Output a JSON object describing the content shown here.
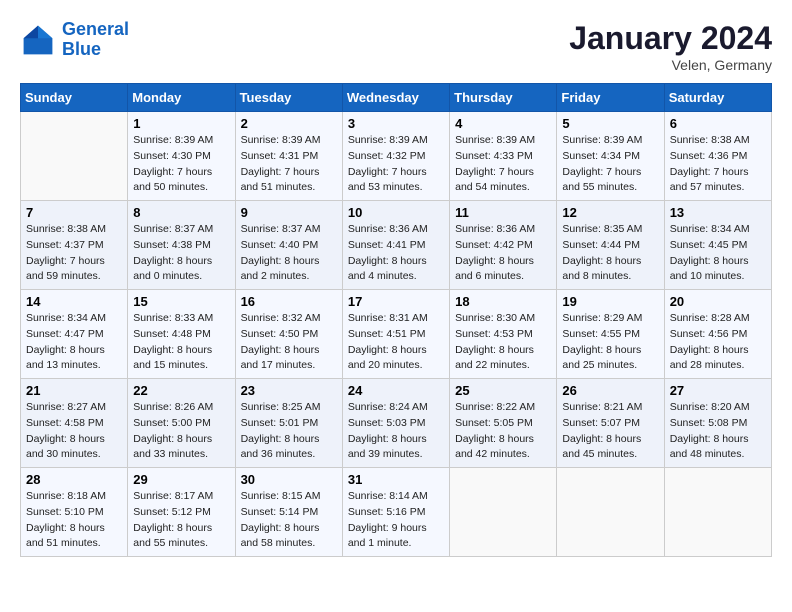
{
  "logo": {
    "line1": "General",
    "line2": "Blue"
  },
  "title": "January 2024",
  "location": "Velen, Germany",
  "days_header": [
    "Sunday",
    "Monday",
    "Tuesday",
    "Wednesday",
    "Thursday",
    "Friday",
    "Saturday"
  ],
  "weeks": [
    [
      {
        "day": "",
        "info": ""
      },
      {
        "day": "1",
        "info": "Sunrise: 8:39 AM\nSunset: 4:30 PM\nDaylight: 7 hours\nand 50 minutes."
      },
      {
        "day": "2",
        "info": "Sunrise: 8:39 AM\nSunset: 4:31 PM\nDaylight: 7 hours\nand 51 minutes."
      },
      {
        "day": "3",
        "info": "Sunrise: 8:39 AM\nSunset: 4:32 PM\nDaylight: 7 hours\nand 53 minutes."
      },
      {
        "day": "4",
        "info": "Sunrise: 8:39 AM\nSunset: 4:33 PM\nDaylight: 7 hours\nand 54 minutes."
      },
      {
        "day": "5",
        "info": "Sunrise: 8:39 AM\nSunset: 4:34 PM\nDaylight: 7 hours\nand 55 minutes."
      },
      {
        "day": "6",
        "info": "Sunrise: 8:38 AM\nSunset: 4:36 PM\nDaylight: 7 hours\nand 57 minutes."
      }
    ],
    [
      {
        "day": "7",
        "info": "Sunrise: 8:38 AM\nSunset: 4:37 PM\nDaylight: 7 hours\nand 59 minutes."
      },
      {
        "day": "8",
        "info": "Sunrise: 8:37 AM\nSunset: 4:38 PM\nDaylight: 8 hours\nand 0 minutes."
      },
      {
        "day": "9",
        "info": "Sunrise: 8:37 AM\nSunset: 4:40 PM\nDaylight: 8 hours\nand 2 minutes."
      },
      {
        "day": "10",
        "info": "Sunrise: 8:36 AM\nSunset: 4:41 PM\nDaylight: 8 hours\nand 4 minutes."
      },
      {
        "day": "11",
        "info": "Sunrise: 8:36 AM\nSunset: 4:42 PM\nDaylight: 8 hours\nand 6 minutes."
      },
      {
        "day": "12",
        "info": "Sunrise: 8:35 AM\nSunset: 4:44 PM\nDaylight: 8 hours\nand 8 minutes."
      },
      {
        "day": "13",
        "info": "Sunrise: 8:34 AM\nSunset: 4:45 PM\nDaylight: 8 hours\nand 10 minutes."
      }
    ],
    [
      {
        "day": "14",
        "info": "Sunrise: 8:34 AM\nSunset: 4:47 PM\nDaylight: 8 hours\nand 13 minutes."
      },
      {
        "day": "15",
        "info": "Sunrise: 8:33 AM\nSunset: 4:48 PM\nDaylight: 8 hours\nand 15 minutes."
      },
      {
        "day": "16",
        "info": "Sunrise: 8:32 AM\nSunset: 4:50 PM\nDaylight: 8 hours\nand 17 minutes."
      },
      {
        "day": "17",
        "info": "Sunrise: 8:31 AM\nSunset: 4:51 PM\nDaylight: 8 hours\nand 20 minutes."
      },
      {
        "day": "18",
        "info": "Sunrise: 8:30 AM\nSunset: 4:53 PM\nDaylight: 8 hours\nand 22 minutes."
      },
      {
        "day": "19",
        "info": "Sunrise: 8:29 AM\nSunset: 4:55 PM\nDaylight: 8 hours\nand 25 minutes."
      },
      {
        "day": "20",
        "info": "Sunrise: 8:28 AM\nSunset: 4:56 PM\nDaylight: 8 hours\nand 28 minutes."
      }
    ],
    [
      {
        "day": "21",
        "info": "Sunrise: 8:27 AM\nSunset: 4:58 PM\nDaylight: 8 hours\nand 30 minutes."
      },
      {
        "day": "22",
        "info": "Sunrise: 8:26 AM\nSunset: 5:00 PM\nDaylight: 8 hours\nand 33 minutes."
      },
      {
        "day": "23",
        "info": "Sunrise: 8:25 AM\nSunset: 5:01 PM\nDaylight: 8 hours\nand 36 minutes."
      },
      {
        "day": "24",
        "info": "Sunrise: 8:24 AM\nSunset: 5:03 PM\nDaylight: 8 hours\nand 39 minutes."
      },
      {
        "day": "25",
        "info": "Sunrise: 8:22 AM\nSunset: 5:05 PM\nDaylight: 8 hours\nand 42 minutes."
      },
      {
        "day": "26",
        "info": "Sunrise: 8:21 AM\nSunset: 5:07 PM\nDaylight: 8 hours\nand 45 minutes."
      },
      {
        "day": "27",
        "info": "Sunrise: 8:20 AM\nSunset: 5:08 PM\nDaylight: 8 hours\nand 48 minutes."
      }
    ],
    [
      {
        "day": "28",
        "info": "Sunrise: 8:18 AM\nSunset: 5:10 PM\nDaylight: 8 hours\nand 51 minutes."
      },
      {
        "day": "29",
        "info": "Sunrise: 8:17 AM\nSunset: 5:12 PM\nDaylight: 8 hours\nand 55 minutes."
      },
      {
        "day": "30",
        "info": "Sunrise: 8:15 AM\nSunset: 5:14 PM\nDaylight: 8 hours\nand 58 minutes."
      },
      {
        "day": "31",
        "info": "Sunrise: 8:14 AM\nSunset: 5:16 PM\nDaylight: 9 hours\nand 1 minute."
      },
      {
        "day": "",
        "info": ""
      },
      {
        "day": "",
        "info": ""
      },
      {
        "day": "",
        "info": ""
      }
    ]
  ]
}
